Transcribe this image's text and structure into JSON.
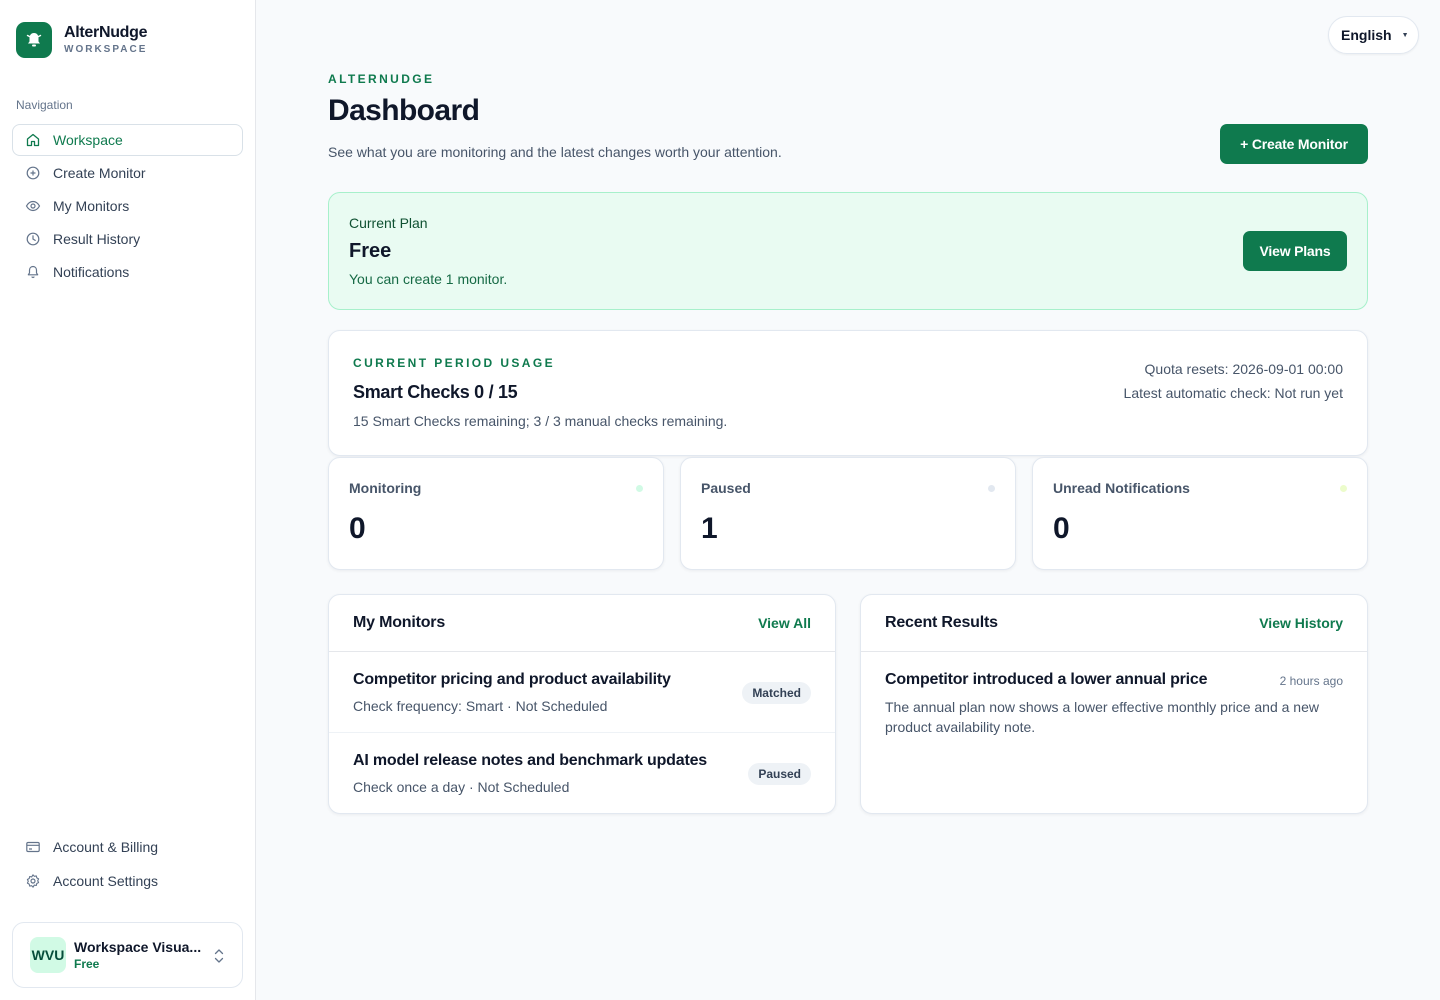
{
  "brand": {
    "name": "AlterNudge",
    "sub": "WORKSPACE"
  },
  "sidebar": {
    "nav_label": "Navigation",
    "items": [
      {
        "label": "Workspace",
        "icon": "home-icon",
        "active": true
      },
      {
        "label": "Create Monitor",
        "icon": "plus-circle-icon"
      },
      {
        "label": "My Monitors",
        "icon": "eye-icon"
      },
      {
        "label": "Result History",
        "icon": "clock-icon"
      },
      {
        "label": "Notifications",
        "icon": "bell-icon"
      }
    ],
    "bottom_items": [
      {
        "label": "Account & Billing",
        "icon": "credit-card-icon"
      },
      {
        "label": "Account Settings",
        "icon": "gear-icon"
      }
    ],
    "workspace": {
      "initials": "WVU",
      "name": "Workspace Visua...",
      "plan": "Free"
    }
  },
  "language": {
    "value": "English"
  },
  "header": {
    "eyebrow": "ALTERNUDGE",
    "title": "Dashboard",
    "subtitle": "See what you are monitoring and the latest changes worth your attention.",
    "create_button": "+ Create Monitor"
  },
  "plan": {
    "label": "Current Plan",
    "name": "Free",
    "description": "You can create 1 monitor.",
    "button": "View Plans"
  },
  "usage": {
    "eyebrow": "CURRENT PERIOD USAGE",
    "title": "Smart Checks 0 / 15",
    "description": "15 Smart Checks remaining; 3 / 3 manual checks remaining.",
    "quota_reset": "Quota resets: 2026-09-01 00:00",
    "latest_check": "Latest automatic check: Not run yet"
  },
  "stats": [
    {
      "label": "Monitoring",
      "value": "0",
      "dot_color": "#d1fae5"
    },
    {
      "label": "Paused",
      "value": "1",
      "dot_color": "#e2e8f0"
    },
    {
      "label": "Unread Notifications",
      "value": "0",
      "dot_color": "#ecfccb"
    }
  ],
  "monitors": {
    "title": "My Monitors",
    "link": "View All",
    "items": [
      {
        "title": "Competitor pricing and product availability",
        "sub": "Check frequency: Smart · Not Scheduled",
        "badge": "Matched"
      },
      {
        "title": "AI model release notes and benchmark updates",
        "sub": "Check once a day · Not Scheduled",
        "badge": "Paused"
      }
    ]
  },
  "results": {
    "title": "Recent Results",
    "link": "View History",
    "items": [
      {
        "title": "Competitor introduced a lower annual price",
        "time": "2 hours ago",
        "description": "The annual plan now shows a lower effective monthly price and a new product availability note."
      }
    ]
  },
  "colors": {
    "accent": "#0f7a4e",
    "plan_bg": "#e9fbf2"
  }
}
